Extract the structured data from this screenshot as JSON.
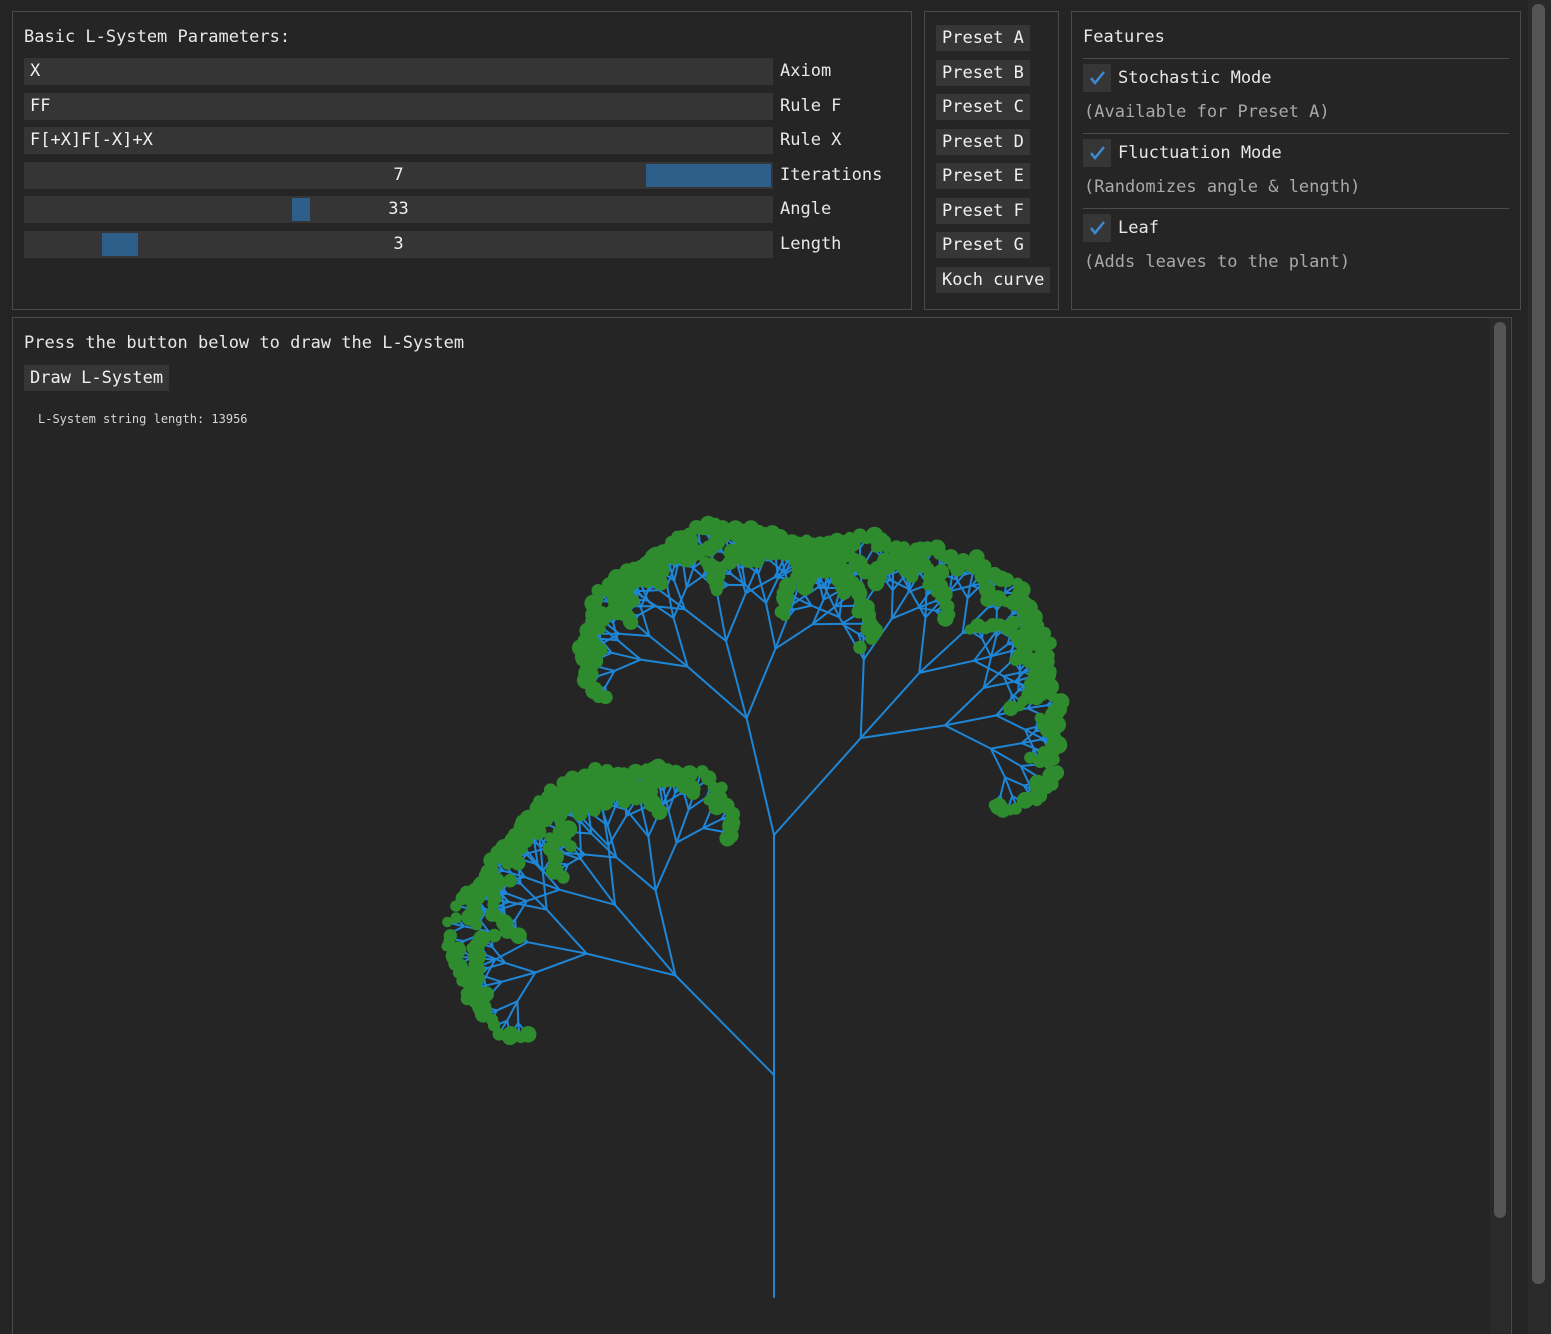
{
  "params": {
    "title": "Basic L-System Parameters:",
    "axiom_value": "X",
    "axiom_label": "Axiom",
    "rule_f_value": "FF",
    "rule_f_label": "Rule F",
    "rule_x_value": "F[+X]F[-X]+X",
    "rule_x_label": "Rule X",
    "iterations_value": "7",
    "iterations_label": "Iterations",
    "angle_value": "33",
    "angle_label": "Angle",
    "length_value": "3",
    "length_label": "Length"
  },
  "presets": [
    "Preset A",
    "Preset B",
    "Preset C",
    "Preset D",
    "Preset E",
    "Preset F",
    "Preset G",
    "Koch curve"
  ],
  "features": {
    "title": "Features",
    "stochastic_label": "Stochastic Mode",
    "stochastic_hint": "(Available for Preset A)",
    "stochastic_checked": true,
    "fluctuation_label": "Fluctuation Mode",
    "fluctuation_hint": "(Randomizes angle & length)",
    "fluctuation_checked": true,
    "leaf_label": "Leaf",
    "leaf_hint": "(Adds leaves to the plant)",
    "leaf_checked": true
  },
  "canvas": {
    "instruction": "Press the button below to draw the L-System",
    "draw_button": "Draw L-System",
    "string_length_text": "L-System string length: 13956"
  },
  "colors": {
    "accent": "#2d5f8a",
    "check": "#3d8ad3",
    "branch": "#1f86d6",
    "leaf": "#2e8b2e"
  }
}
